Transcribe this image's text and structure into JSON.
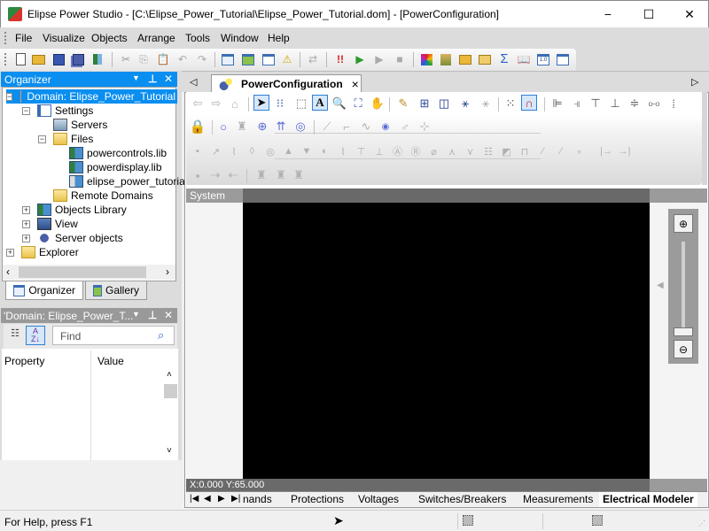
{
  "window": {
    "title": "Elipse Power Studio - [C:\\Elipse_Power_Tutorial\\Elipse_Power_Tutorial.dom] - [PowerConfiguration]",
    "minimize_icon": "−",
    "maximize_icon": "☐",
    "close_icon": "✕"
  },
  "menu": [
    "File",
    "Visualize",
    "Objects",
    "Arrange",
    "Tools",
    "Window",
    "Help"
  ],
  "toolbar": {
    "buttons": [
      "new",
      "open",
      "save",
      "save-all",
      "check-in",
      "cut",
      "copy",
      "paste",
      "undo",
      "redo",
      "organizer",
      "gallery",
      "properties",
      "verify",
      "compare",
      "run",
      "execute",
      "execute-disabled",
      "stop",
      "app-colors",
      "object-wizard",
      "find",
      "find-objects",
      "sum",
      "help-book",
      "version",
      "app-config"
    ]
  },
  "organizer": {
    "title": "Organizer",
    "dropdown_icon": "▼",
    "pin_icon": "Ӏ",
    "close_icon": "✕",
    "tree": [
      {
        "label": "Domain: Elipse_Power_Tutorial",
        "level": 0,
        "expander": "−",
        "selected": true,
        "icon": "domain-icon"
      },
      {
        "label": "Settings",
        "level": 1,
        "expander": "−",
        "icon": "settings-icon"
      },
      {
        "label": "Servers",
        "level": 2,
        "expander": "",
        "icon": "servers-icon"
      },
      {
        "label": "Files",
        "level": 2,
        "expander": "−",
        "icon": "folder-icon"
      },
      {
        "label": "powercontrols.lib",
        "level": 3,
        "expander": "",
        "icon": "library-icon"
      },
      {
        "label": "powerdisplay.lib",
        "level": 3,
        "expander": "",
        "icon": "library-icon"
      },
      {
        "label": "elipse_power_tutorial",
        "level": 3,
        "expander": "",
        "icon": "library-file-icon"
      },
      {
        "label": "Remote Domains",
        "level": 2,
        "expander": "",
        "icon": "folder-icon"
      },
      {
        "label": "Objects Library",
        "level": 1,
        "expander": "+",
        "icon": "library-icon"
      },
      {
        "label": "View",
        "level": 1,
        "expander": "+",
        "icon": "view-icon"
      },
      {
        "label": "Server objects",
        "level": 1,
        "expander": "+",
        "icon": "gears-icon"
      },
      {
        "label": "Explorer",
        "level": 0,
        "expander": "+",
        "icon": "folder-icon"
      }
    ],
    "tabs": [
      "Organizer",
      "Gallery"
    ]
  },
  "properties": {
    "title": "'Domain: Elipse_Power_T...",
    "find_placeholder": "Find",
    "columns": [
      "Property",
      "Value"
    ]
  },
  "document": {
    "tab_label": "PowerConfiguration",
    "tab_close": "×",
    "system_label": "System",
    "coordinates": "X:0.000 Y:65.000",
    "sheet_tabs": [
      "nands",
      "Protections",
      "Voltages",
      "Switches/Breakers",
      "Measurements",
      "Electrical Modeler"
    ],
    "active_sheet": "Electrical Modeler",
    "nav_buttons": [
      "|◀",
      "◀",
      "▶",
      "▶|"
    ]
  },
  "status": {
    "help_text": "For Help, press F1"
  }
}
